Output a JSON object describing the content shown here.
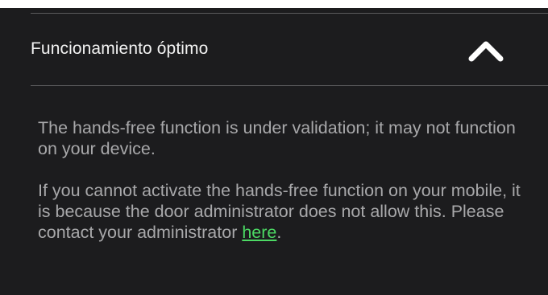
{
  "accordion": {
    "title": "Funcionamiento óptimo",
    "toggle_icon": "chevron-up-icon",
    "expanded": true
  },
  "content": {
    "paragraph1": "The hands-free function is under validation; it may not function on your device.",
    "paragraph2_text": "If you cannot activate the hands-free function on your mobile, it is because the door administrator does not allow this. Please contact your administrator ",
    "paragraph2_link": "here",
    "paragraph2_end": "."
  },
  "colors": {
    "background": "#1c1c1e",
    "title_text": "#f2f2f2",
    "body_text": "#a8a8aa",
    "link": "#4cd964",
    "divider": "#5a5a5c"
  }
}
